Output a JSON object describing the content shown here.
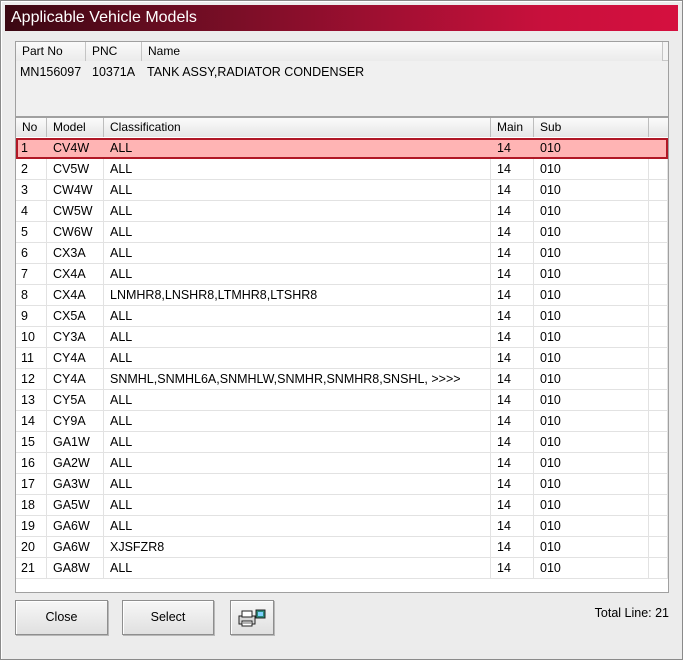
{
  "window": {
    "title": "Applicable Vehicle Models"
  },
  "part_header": {
    "columns": [
      "Part No",
      "PNC",
      "Name"
    ],
    "part_no": "MN156097",
    "pnc": "10371A",
    "name": "TANK ASSY,RADIATOR CONDENSER"
  },
  "model_list": {
    "columns": [
      "No",
      "Model",
      "Classification",
      "Main",
      "Sub"
    ],
    "selected_index": 0,
    "rows": [
      {
        "no": "1",
        "model": "CV4W",
        "classification": "ALL",
        "main": "14",
        "sub": "010"
      },
      {
        "no": "2",
        "model": "CV5W",
        "classification": "ALL",
        "main": "14",
        "sub": "010"
      },
      {
        "no": "3",
        "model": "CW4W",
        "classification": "ALL",
        "main": "14",
        "sub": "010"
      },
      {
        "no": "4",
        "model": "CW5W",
        "classification": "ALL",
        "main": "14",
        "sub": "010"
      },
      {
        "no": "5",
        "model": "CW6W",
        "classification": "ALL",
        "main": "14",
        "sub": "010"
      },
      {
        "no": "6",
        "model": "CX3A",
        "classification": "ALL",
        "main": "14",
        "sub": "010"
      },
      {
        "no": "7",
        "model": "CX4A",
        "classification": "ALL",
        "main": "14",
        "sub": "010"
      },
      {
        "no": "8",
        "model": "CX4A",
        "classification": "LNMHR8,LNSHR8,LTMHR8,LTSHR8",
        "main": "14",
        "sub": "010"
      },
      {
        "no": "9",
        "model": "CX5A",
        "classification": "ALL",
        "main": "14",
        "sub": "010"
      },
      {
        "no": "10",
        "model": "CY3A",
        "classification": "ALL",
        "main": "14",
        "sub": "010"
      },
      {
        "no": "11",
        "model": "CY4A",
        "classification": "ALL",
        "main": "14",
        "sub": "010"
      },
      {
        "no": "12",
        "model": "CY4A",
        "classification": "SNMHL,SNMHL6A,SNMHLW,SNMHR,SNMHR8,SNSHL,  >>>>",
        "main": "14",
        "sub": "010"
      },
      {
        "no": "13",
        "model": "CY5A",
        "classification": "ALL",
        "main": "14",
        "sub": "010"
      },
      {
        "no": "14",
        "model": "CY9A",
        "classification": "ALL",
        "main": "14",
        "sub": "010"
      },
      {
        "no": "15",
        "model": "GA1W",
        "classification": "ALL",
        "main": "14",
        "sub": "010"
      },
      {
        "no": "16",
        "model": "GA2W",
        "classification": "ALL",
        "main": "14",
        "sub": "010"
      },
      {
        "no": "17",
        "model": "GA3W",
        "classification": "ALL",
        "main": "14",
        "sub": "010"
      },
      {
        "no": "18",
        "model": "GA5W",
        "classification": "ALL",
        "main": "14",
        "sub": "010"
      },
      {
        "no": "19",
        "model": "GA6W",
        "classification": "ALL",
        "main": "14",
        "sub": "010"
      },
      {
        "no": "20",
        "model": "GA6W",
        "classification": "XJSFZR8",
        "main": "14",
        "sub": "010"
      },
      {
        "no": "21",
        "model": "GA8W",
        "classification": "ALL",
        "main": "14",
        "sub": "010"
      }
    ]
  },
  "buttons": {
    "close_label": "Close",
    "select_label": "Select",
    "print_icon": "printer-icon"
  },
  "footer": {
    "total_line": "Total Line: 21"
  },
  "colors": {
    "title_start": "#3a0712",
    "title_end": "#d5103f",
    "selected_row": "#ffb4b4",
    "selected_border": "#b01826"
  }
}
